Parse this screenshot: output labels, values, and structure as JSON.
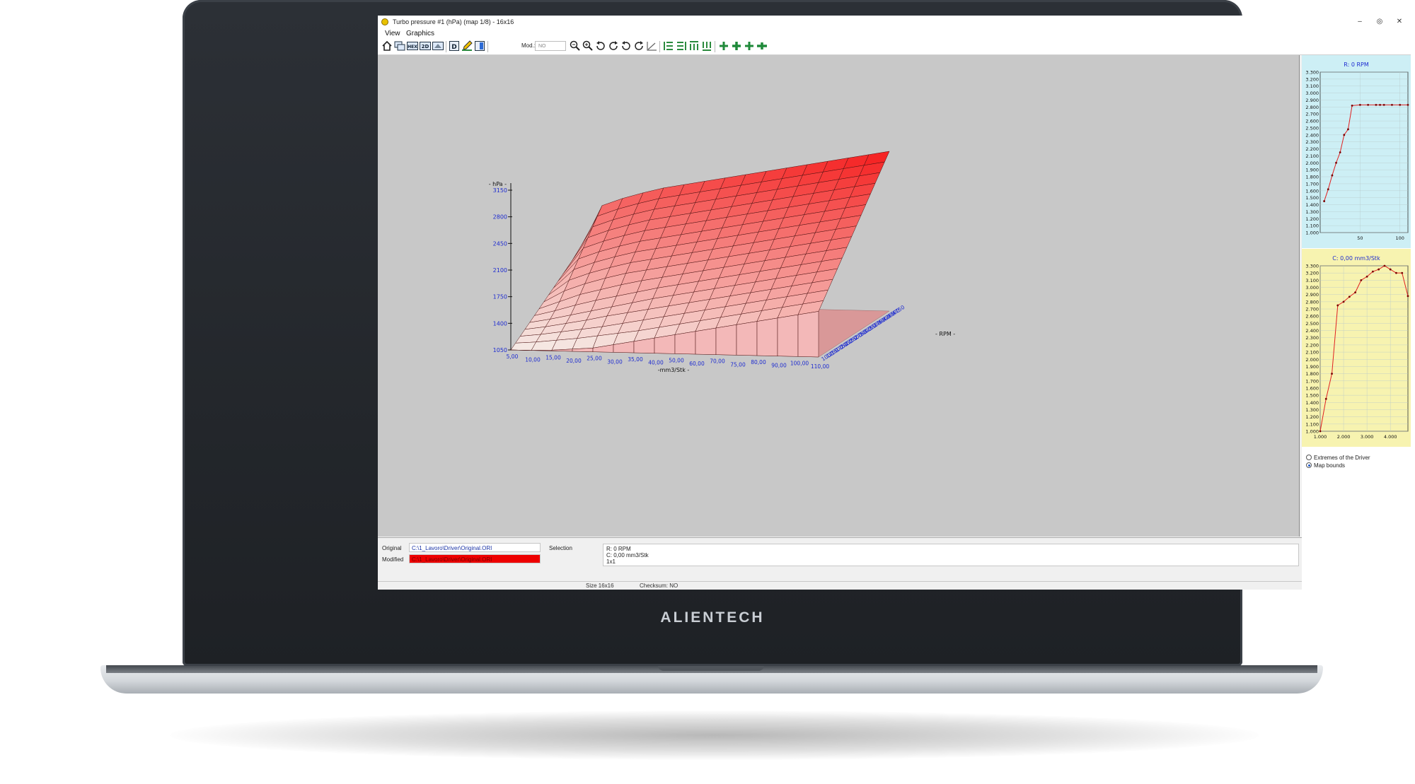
{
  "window": {
    "title": "Turbo pressure #1 (hPa) (map 1/8) - 16x16",
    "minimize_glyph": "–",
    "restore_glyph": "◎",
    "close_glyph": "✕"
  },
  "menu": [
    "View",
    "Graphics"
  ],
  "toolbar": {
    "mod_label": "Mod.:",
    "mod_value": "NO",
    "icons": [
      "home-icon",
      "windows-icon",
      "hex-view-icon",
      "2d-view-icon",
      "3d-view-icon",
      "d-icon",
      "pencil-icon",
      "b-icon",
      "zoom-out-icon",
      "zoom-in-icon",
      "rotate-left-icon",
      "rotate-up-icon",
      "rotate-down-icon",
      "rotate-right-icon",
      "axes-icon",
      "rows-left-icon",
      "rows-right-icon",
      "cols-up-icon",
      "cols-down-icon",
      "plus-green-icon",
      "plus-green-bold-icon",
      "plus-green-small-icon",
      "plus-green-wide-icon"
    ]
  },
  "chart_data": [
    {
      "type": "surface",
      "zlabel": "- hPa -",
      "xlabel": "-mm3/Stk -",
      "ylabel": "- RPM -",
      "z_ticks": [
        "1050",
        "1400",
        "1750",
        "2100",
        "2450",
        "2800",
        "3150"
      ],
      "x_ticks": [
        "5,00",
        "10,00",
        "15,00",
        "20,00",
        "25,00",
        "30,00",
        "35,00",
        "40,00",
        "50,00",
        "60,00",
        "70,00",
        "75,00",
        "80,00",
        "90,00",
        "100,00",
        "110,00"
      ],
      "y_ticks": [
        "1000",
        "1250",
        "1500",
        "1750",
        "2000",
        "2250",
        "2500",
        "2750",
        "3000",
        "3250",
        "3500",
        "3750",
        "4000",
        "4250",
        "4500",
        "4750"
      ],
      "z_grid_approx": [
        [
          1050,
          1050,
          1060,
          1080,
          1100,
          1150,
          1200,
          1250,
          1300,
          1350,
          1400,
          1450,
          1500,
          1550,
          1600,
          1650
        ],
        [
          1100,
          1120,
          1150,
          1180,
          1220,
          1260,
          1300,
          1350,
          1400,
          1450,
          1500,
          1550,
          1600,
          1650,
          1700,
          1750
        ],
        [
          1150,
          1180,
          1220,
          1260,
          1300,
          1350,
          1400,
          1450,
          1500,
          1550,
          1600,
          1650,
          1700,
          1750,
          1800,
          1850
        ],
        [
          1200,
          1240,
          1290,
          1340,
          1400,
          1450,
          1500,
          1550,
          1600,
          1650,
          1700,
          1750,
          1800,
          1850,
          1900,
          1950
        ],
        [
          1250,
          1300,
          1360,
          1420,
          1480,
          1540,
          1600,
          1650,
          1700,
          1750,
          1800,
          1850,
          1900,
          1950,
          2000,
          2050
        ],
        [
          1300,
          1370,
          1450,
          1520,
          1580,
          1640,
          1700,
          1750,
          1800,
          1850,
          1900,
          1950,
          2000,
          2050,
          2100,
          2150
        ],
        [
          1350,
          1450,
          1550,
          1620,
          1690,
          1750,
          1800,
          1850,
          1900,
          1950,
          2000,
          2050,
          2100,
          2150,
          2200,
          2250
        ],
        [
          1400,
          1550,
          1650,
          1730,
          1800,
          1850,
          1900,
          1950,
          2000,
          2050,
          2100,
          2150,
          2200,
          2250,
          2300,
          2350
        ],
        [
          1450,
          1650,
          1750,
          1830,
          1900,
          1950,
          2000,
          2050,
          2100,
          2150,
          2200,
          2250,
          2300,
          2350,
          2400,
          2450
        ],
        [
          1500,
          1750,
          1850,
          1930,
          2000,
          2050,
          2100,
          2150,
          2200,
          2250,
          2300,
          2350,
          2400,
          2450,
          2500,
          2550
        ],
        [
          1550,
          1850,
          1950,
          2030,
          2100,
          2150,
          2200,
          2250,
          2300,
          2350,
          2400,
          2450,
          2500,
          2550,
          2600,
          2650
        ],
        [
          1600,
          1950,
          2050,
          2130,
          2200,
          2250,
          2300,
          2350,
          2400,
          2450,
          2500,
          2550,
          2600,
          2650,
          2700,
          2750
        ],
        [
          1650,
          2050,
          2150,
          2230,
          2300,
          2350,
          2400,
          2450,
          2500,
          2550,
          2600,
          2650,
          2700,
          2750,
          2800,
          2850
        ],
        [
          1700,
          2150,
          2250,
          2330,
          2400,
          2450,
          2500,
          2550,
          2600,
          2650,
          2700,
          2750,
          2800,
          2850,
          2900,
          2950
        ],
        [
          1750,
          2250,
          2350,
          2430,
          2500,
          2550,
          2600,
          2650,
          2700,
          2750,
          2800,
          2850,
          2900,
          2950,
          3000,
          3050
        ],
        [
          1800,
          2350,
          2450,
          2530,
          2600,
          2650,
          2700,
          2750,
          2800,
          2850,
          2900,
          2950,
          3000,
          3050,
          3100,
          3150
        ]
      ],
      "surface_color": "#ee1c1c",
      "floor_color": "#d99898",
      "background": "#c8c8c8"
    },
    {
      "type": "line",
      "title": "R: 0 RPM",
      "y_ticks": [
        "1.000",
        "1.100",
        "1.200",
        "1.300",
        "1.400",
        "1.500",
        "1.600",
        "1.700",
        "1.800",
        "1.900",
        "2.000",
        "2.100",
        "2.200",
        "2.300",
        "2.400",
        "2.500",
        "2.600",
        "2.700",
        "2.800",
        "2.900",
        "3.000",
        "3.100",
        "3.200",
        "3.300"
      ],
      "ylim": [
        1.0,
        3.3
      ],
      "x_ticks": [
        "50",
        "100"
      ],
      "xlim": [
        0,
        110
      ],
      "x": [
        5,
        10,
        15,
        20,
        25,
        30,
        35,
        40,
        50,
        60,
        70,
        75,
        80,
        90,
        100,
        110
      ],
      "y": [
        1.45,
        1.62,
        1.82,
        2.0,
        2.15,
        2.4,
        2.48,
        2.82,
        2.83,
        2.83,
        2.83,
        2.83,
        2.83,
        2.83,
        2.83,
        2.83
      ],
      "line_color": "#e02020",
      "background": "#cdeff5"
    },
    {
      "type": "line",
      "title": "C: 0,00 mm3/Stk",
      "y_ticks": [
        "1.000",
        "1.100",
        "1.200",
        "1.300",
        "1.400",
        "1.500",
        "1.600",
        "1.700",
        "1.800",
        "1.900",
        "2.000",
        "2.100",
        "2.200",
        "2.300",
        "2.400",
        "2.500",
        "2.600",
        "2.700",
        "2.800",
        "2.900",
        "3.000",
        "3.100",
        "3.200",
        "3.300"
      ],
      "ylim": [
        1.0,
        3.3
      ],
      "x_ticks": [
        "1.000",
        "2.000",
        "3.000",
        "4.000"
      ],
      "xlim": [
        1000,
        4750
      ],
      "x": [
        1000,
        1250,
        1500,
        1750,
        2000,
        2250,
        2500,
        2750,
        3000,
        3250,
        3500,
        3750,
        4000,
        4250,
        4500,
        4750
      ],
      "y": [
        1.0,
        1.45,
        1.8,
        2.75,
        2.8,
        2.87,
        2.93,
        3.1,
        3.15,
        3.22,
        3.25,
        3.3,
        3.25,
        3.2,
        3.2,
        2.88
      ],
      "line_color": "#e02020",
      "background": "#f7f3b0"
    }
  ],
  "side_options": {
    "opt1": "Extremes of the Driver",
    "opt2": "Map bounds",
    "selected": "Map bounds"
  },
  "info": {
    "original_label": "Original",
    "original_path": "C:\\1_Lavoro\\Driver\\Original.ORI",
    "modified_label": "Modified",
    "modified_path": "C:\\1_Lavoro\\Driver\\Original.ORI",
    "selection_label": "Selection",
    "selection_lines": [
      "R: 0 RPM",
      "C: 0,00 mm3/Stk",
      "1x1"
    ]
  },
  "status": {
    "size": "Size 16x16",
    "checksum": "Checksum: NO"
  },
  "brand": "ALIENTECH"
}
